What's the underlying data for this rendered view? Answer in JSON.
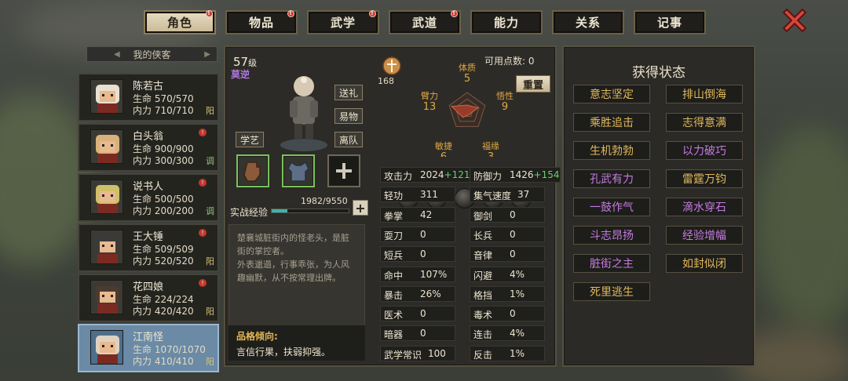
{
  "tabs": [
    {
      "label": "角色",
      "active": true,
      "badge": true
    },
    {
      "label": "物品",
      "active": false,
      "badge": true
    },
    {
      "label": "武学",
      "active": false,
      "badge": true
    },
    {
      "label": "武道",
      "active": false,
      "badge": true
    },
    {
      "label": "能力",
      "active": false,
      "badge": false
    },
    {
      "label": "关系",
      "active": false,
      "badge": false
    },
    {
      "label": "记事",
      "active": false,
      "badge": false
    }
  ],
  "list_title": "我的侠客",
  "heroes": [
    {
      "name": "陈若古",
      "hp": "生命 570/570",
      "mp": "内力 710/710",
      "align": "阳",
      "badge": false
    },
    {
      "name": "白头翁",
      "hp": "生命 900/900",
      "mp": "内力 300/300",
      "align": "调",
      "badge": true
    },
    {
      "name": "说书人",
      "hp": "生命 500/500",
      "mp": "内力 200/200",
      "align": "调",
      "badge": true
    },
    {
      "name": "王大锤",
      "hp": "生命 509/509",
      "mp": "内力 520/520",
      "align": "阳",
      "badge": true
    },
    {
      "name": "花四娘",
      "hp": "生命 224/224",
      "mp": "内力 420/420",
      "align": "阳",
      "badge": true
    },
    {
      "name": "江南怪",
      "hp": "生命 1070/1070",
      "mp": "内力 410/410",
      "align": "阳",
      "badge": false
    }
  ],
  "character": {
    "level": "57",
    "level_suffix": "级",
    "sect": "莫逆",
    "buttons": {
      "gift": "送礼",
      "trade": "易物",
      "leave": "离队",
      "learn": "学艺"
    },
    "exp_label": "实战经验",
    "exp_text": "1982/9550",
    "exp_progress": 0.208,
    "bust_points": "168",
    "available_points_label": "可用点数:",
    "available_points": "0",
    "reset_label": "重置",
    "description": "楚襄城脏街内的怪老头，是脏街的掌控者。\n外表邋遢，行事乖张，为人风趣幽默，从不按常理出牌。",
    "trait_title": "品格倾向:",
    "trait_text": "言信行果，扶弱抑强。"
  },
  "attributes": [
    {
      "name": "体质",
      "value": "5"
    },
    {
      "name": "悟性",
      "value": "9"
    },
    {
      "name": "福缘",
      "value": "3"
    },
    {
      "name": "敏捷",
      "value": "6"
    },
    {
      "name": "臂力",
      "value": "13"
    }
  ],
  "stats_left": [
    {
      "label": "攻击力",
      "value": "2024",
      "bonus": "+121"
    },
    {
      "label": "轻功",
      "value": "311"
    },
    {
      "label": "拳掌",
      "value": "42"
    },
    {
      "label": "耍刀",
      "value": "0"
    },
    {
      "label": "短兵",
      "value": "0"
    },
    {
      "label": "命中",
      "value": "107%"
    },
    {
      "label": "暴击",
      "value": "26%"
    },
    {
      "label": "医术",
      "value": "0"
    },
    {
      "label": "暗器",
      "value": "0"
    },
    {
      "label": "武学常识",
      "value": "100"
    }
  ],
  "stats_right": [
    {
      "label": "防御力",
      "value": "1426",
      "bonus": "+154"
    },
    {
      "label": "集气速度",
      "value": "37"
    },
    {
      "label": "御剑",
      "value": "0"
    },
    {
      "label": "长兵",
      "value": "0"
    },
    {
      "label": "音律",
      "value": "0"
    },
    {
      "label": "闪避",
      "value": "4%"
    },
    {
      "label": "格挡",
      "value": "1%"
    },
    {
      "label": "毒术",
      "value": "0"
    },
    {
      "label": "连击",
      "value": "4%"
    },
    {
      "label": "反击",
      "value": "1%"
    }
  ],
  "status_panel": {
    "title": "获得状态",
    "items": [
      {
        "label": "意志坚定",
        "color": "gold"
      },
      {
        "label": "排山倒海",
        "color": "gold"
      },
      {
        "label": "乘胜追击",
        "color": "gold"
      },
      {
        "label": "志得意满",
        "color": "gold"
      },
      {
        "label": "生机勃勃",
        "color": "gold"
      },
      {
        "label": "以力破巧",
        "color": "purple"
      },
      {
        "label": "孔武有力",
        "color": "purple"
      },
      {
        "label": "雷霆万钧",
        "color": "gold"
      },
      {
        "label": "一鼓作气",
        "color": "purple"
      },
      {
        "label": "滴水穿石",
        "color": "purple"
      },
      {
        "label": "斗志昂扬",
        "color": "purple"
      },
      {
        "label": "经验增幅",
        "color": "purple"
      },
      {
        "label": "脏街之主",
        "color": "purple"
      },
      {
        "label": "如封似闭",
        "color": "gold"
      },
      {
        "label": "死里逃生",
        "color": "gold"
      }
    ]
  }
}
